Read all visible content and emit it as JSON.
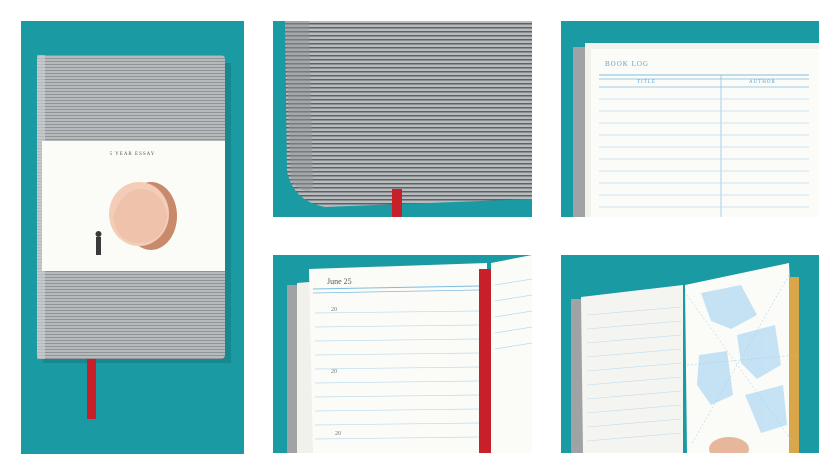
{
  "colors": {
    "background": "#ffffff",
    "teal": "#1a9aa2",
    "cover_grey": "#aeb2b4",
    "ribbon": "#c8202a",
    "page_blue": "#7fbde0",
    "paper": "#fbfbf8"
  },
  "panels": {
    "main": {
      "band_label": "5 YEAR ESSAY",
      "illustration_icon": "tree-stump-with-figure"
    },
    "spine_closeup": {},
    "book_log": {
      "heading": "BOOK LOG",
      "col_title": "TITLE",
      "col_author": "AUTHOR"
    },
    "journal_page": {
      "date": "June 25",
      "year_prefixes": [
        "20",
        "20",
        "20"
      ]
    },
    "map_page": {}
  }
}
